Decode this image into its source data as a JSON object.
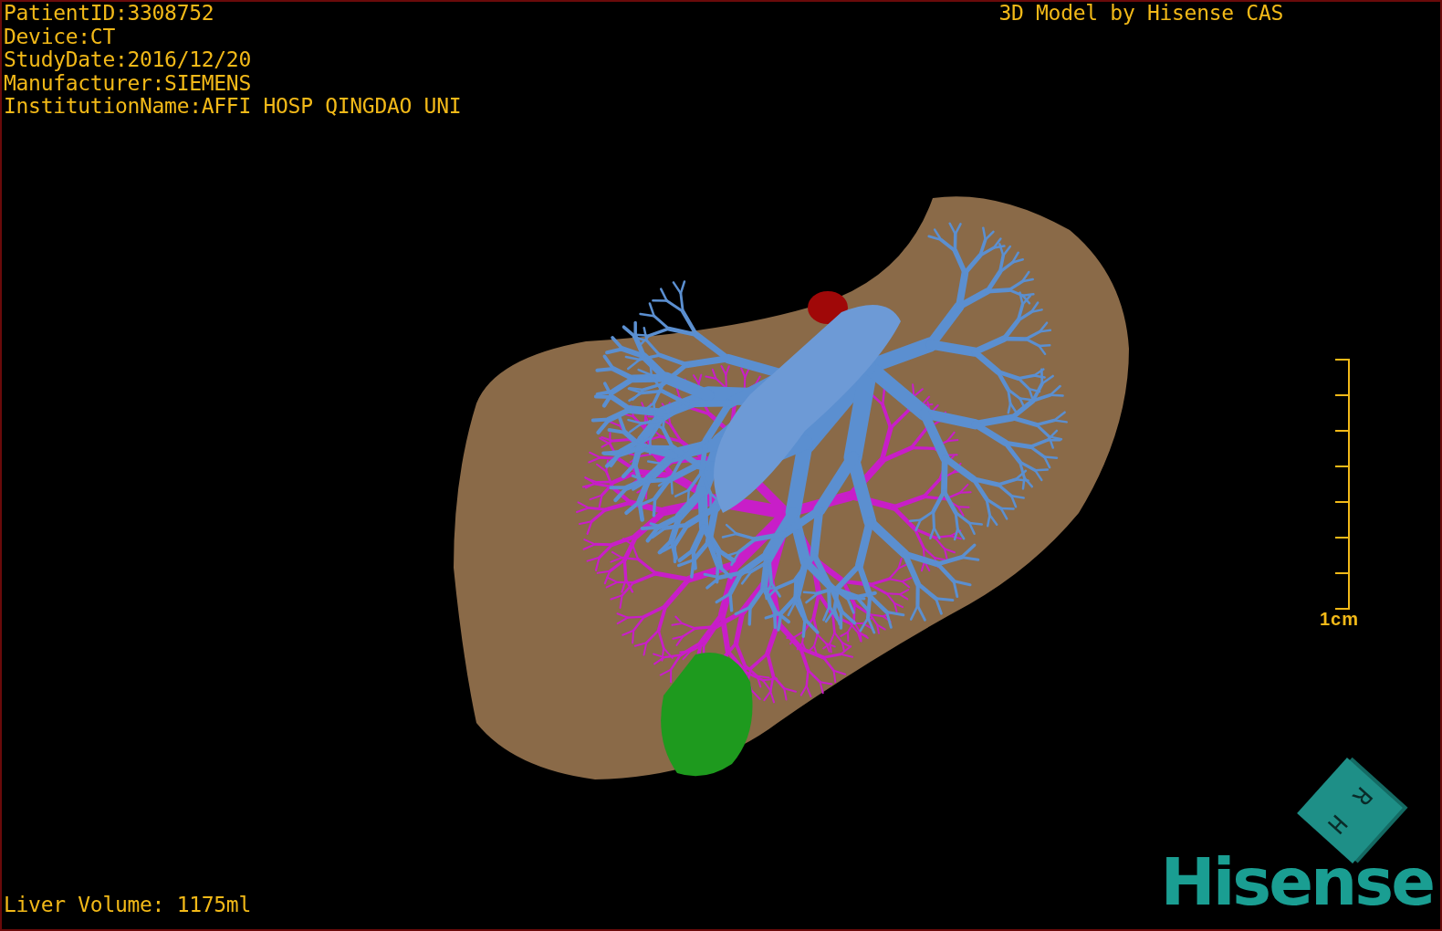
{
  "study_info": [
    "PatientID:3308752",
    "Device:CT",
    "StudyDate:2016/12/20",
    "Manufacturer:SIEMENS",
    "InstitutionName:AFFI HOSP QINGDAO UNI"
  ],
  "model_credit": "3D Model by Hisense CAS",
  "scale_bar": {
    "label": "1cm"
  },
  "liver_volume": "Liver Volume: 1175ml",
  "orientation_cube": {
    "labels": [
      "H",
      "R"
    ]
  },
  "logo": "Hisense"
}
